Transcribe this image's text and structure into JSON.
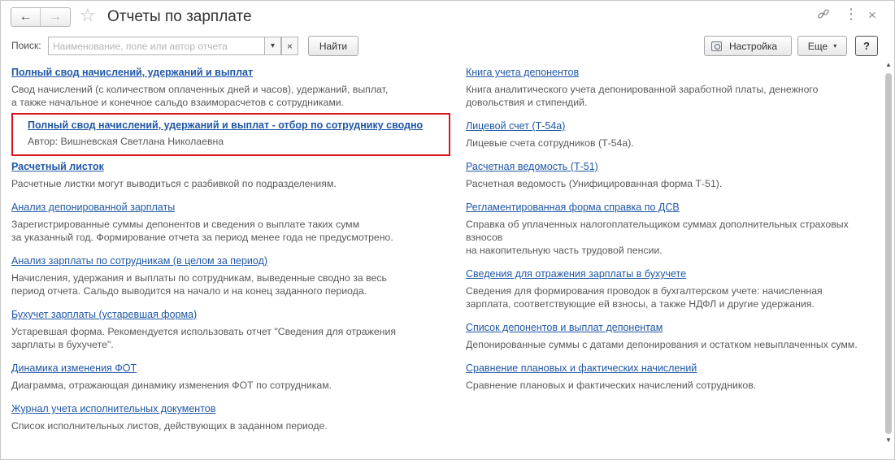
{
  "window": {
    "title": "Отчеты по зарплате",
    "back_icon": "←",
    "forward_icon": "→",
    "star_icon": "☆",
    "link_icon": "🔗",
    "more_icon": "⋮",
    "close_icon": "×"
  },
  "toolbar": {
    "search_label": "Поиск:",
    "search_placeholder": "Наименование, поле или автор отчета",
    "search_value": "",
    "dropdown_icon": "▾",
    "clear_icon": "×",
    "find_label": "Найти",
    "settings_label": "Настройка",
    "more_label": "Еще",
    "more_caret": "▾",
    "help_label": "?"
  },
  "left_reports": [
    {
      "title": "Полный свод начислений, удержаний и выплат",
      "desc_lines": [
        "Свод начислений (с количеством оплаченных дней и часов), удержаний, выплат,",
        "а также начальное и конечное сальдо взаиморасчетов с сотрудниками."
      ]
    },
    {
      "title": "Расчетный листок",
      "desc_lines": [
        "Расчетные листки могут выводиться с разбивкой по подразделениям."
      ]
    },
    {
      "title": "Анализ депонированной зарплаты",
      "desc_lines": [
        "Зарегистрированные суммы депонентов и сведения о выплате таких сумм",
        "за указанный год. Формирование отчета за период менее года не предусмотрено."
      ]
    },
    {
      "title": "Анализ зарплаты по сотрудникам (в целом за период)",
      "desc_lines": [
        "Начисления, удержания и выплаты по сотрудникам, выведенные сводно за весь",
        "период отчета. Сальдо выводится на начало и на конец заданного периода."
      ]
    },
    {
      "title": "Бухучет зарплаты (устаревшая форма)",
      "desc_lines": [
        "Устаревшая форма. Рекомендуется использовать отчет \"Сведения для отражения",
        "зарплаты в бухучете\"."
      ]
    },
    {
      "title": "Динамика изменения ФОТ",
      "desc_lines": [
        "Диаграмма, отражающая динамику изменения ФОТ по сотрудникам."
      ]
    },
    {
      "title": "Журнал учета исполнительных документов",
      "desc_lines": [
        "Список исполнительных листов, действующих в заданном периоде."
      ]
    }
  ],
  "sub_report": {
    "title": "Полный свод начислений, удержаний и выплат - отбор по сотруднику сводно",
    "author": "Автор: Вишневская Светлана Николаевна"
  },
  "right_reports": [
    {
      "title": "Книга учета депонентов",
      "desc_lines": [
        "Книга аналитического учета депонированной заработной платы, денежного",
        "довольствия и стипендий."
      ]
    },
    {
      "title": "Лицевой счет (Т-54а)",
      "desc_lines": [
        "Лицевые счета сотрудников (Т-54а)."
      ]
    },
    {
      "title": "Расчетная ведомость (Т-51)",
      "desc_lines": [
        "Расчетная ведомость (Унифицированная форма Т-51)."
      ]
    },
    {
      "title": "Регламентированная форма справка по ДСВ",
      "desc_lines": [
        "Справка об уплаченных налогоплательщиком суммах дополнительных страховых",
        "взносов",
        "на накопительную часть трудовой пенсии."
      ]
    },
    {
      "title": "Сведения для отражения зарплаты в бухучете",
      "desc_lines": [
        "Сведения для формирования проводок в бухгалтерском учете: начисленная",
        "зарплата, соответствующие ей взносы, а также НДФЛ и другие удержания."
      ]
    },
    {
      "title": "Список депонентов и выплат депонентам",
      "desc_lines": [
        "Депонированные суммы с датами депонирования и остатком невыплаченных сумм."
      ]
    },
    {
      "title": "Сравнение плановых и фактических начислений",
      "desc_lines": [
        "Сравнение плановых и фактических начислений сотрудников."
      ]
    }
  ],
  "scrollbar": {
    "up_icon": "▲",
    "down_icon": "▼"
  }
}
